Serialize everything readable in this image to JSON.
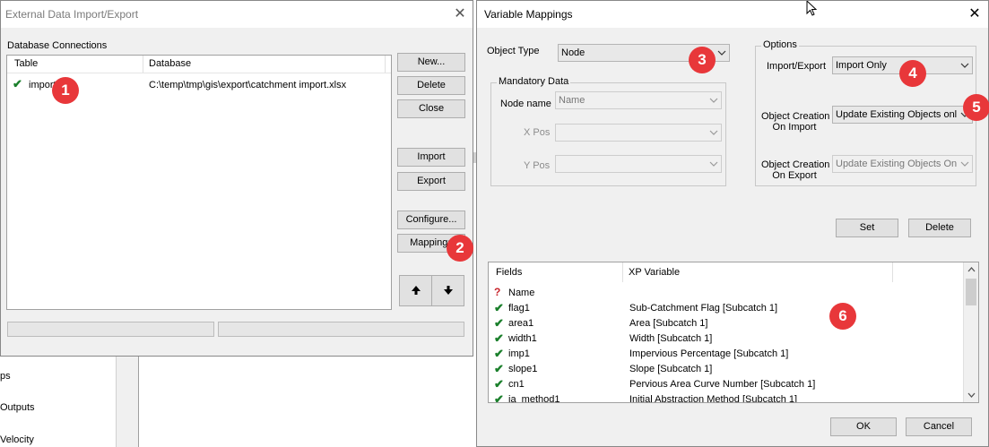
{
  "background_app": {
    "sidebar_items": [
      "ps",
      "Outputs",
      "Velocity"
    ]
  },
  "import_export_dialog": {
    "title": "External Data Import/Export",
    "group_label": "Database Connections",
    "columns": [
      "Table",
      "Database"
    ],
    "rows": [
      {
        "table": "import",
        "database": "C:\\temp\\tmp\\gis\\export\\catchment import.xlsx"
      }
    ],
    "buttons": {
      "new": "New...",
      "delete": "Delete",
      "close": "Close",
      "import": "Import",
      "export": "Export",
      "configure": "Configure...",
      "mappings": "Mappings"
    },
    "move_up_icon": "arrow-up-icon",
    "move_down_icon": "arrow-down-icon"
  },
  "mappings_dialog": {
    "title": "Variable Mappings",
    "object_type_label": "Object Type",
    "object_type_value": "Node",
    "mandatory_group": "Mandatory Data",
    "node_name_label": "Node name",
    "node_name_value": "Name",
    "x_pos_label": "X Pos",
    "y_pos_label": "Y Pos",
    "options_group": "Options",
    "import_export_label": "Import/Export",
    "import_export_value": "Import Only",
    "creation_import_label_1": "Object Creation",
    "creation_import_label_2": "On Import",
    "creation_import_value": "Update Existing Objects onl",
    "creation_export_label_1": "Object Creation",
    "creation_export_label_2": "On Export",
    "creation_export_value": "Update Existing Objects On",
    "set_button": "Set",
    "delete_button": "Delete",
    "columns": [
      "Fields",
      "XP Variable"
    ],
    "rows": [
      {
        "status": "missing",
        "field": "Name",
        "variable": ""
      },
      {
        "status": "ok",
        "field": "flag1",
        "variable": "Sub-Catchment Flag [Subcatch 1]"
      },
      {
        "status": "ok",
        "field": "area1",
        "variable": "Area [Subcatch 1]"
      },
      {
        "status": "ok",
        "field": "width1",
        "variable": "Width [Subcatch 1]"
      },
      {
        "status": "ok",
        "field": "imp1",
        "variable": "Impervious Percentage [Subcatch 1]"
      },
      {
        "status": "ok",
        "field": "slope1",
        "variable": "Slope [Subcatch 1]"
      },
      {
        "status": "ok",
        "field": "cn1",
        "variable": "Pervious Area Curve Number [Subcatch 1]"
      },
      {
        "status": "ok",
        "field": "ia_method1",
        "variable": "Initial Abstraction Method [Subcatch 1]"
      }
    ],
    "ok_button": "OK",
    "cancel_button": "Cancel"
  },
  "annotations": [
    "1",
    "2",
    "3",
    "4",
    "5",
    "6"
  ]
}
